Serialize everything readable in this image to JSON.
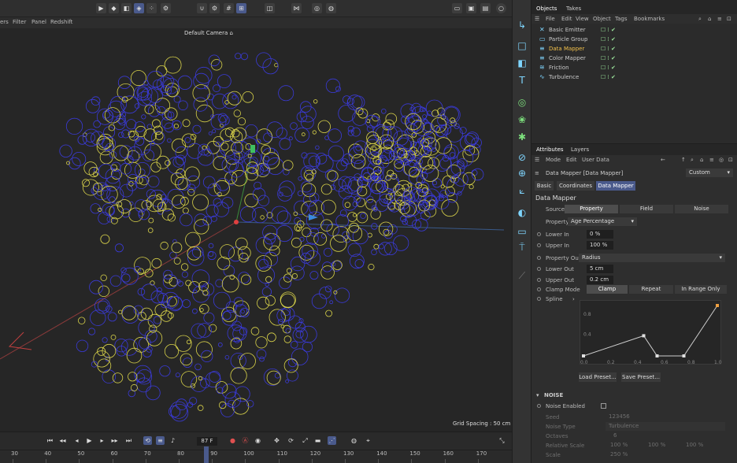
{
  "viewport": {
    "menu": [
      "ers",
      "Filter",
      "Panel",
      "Redshift"
    ],
    "camera_label": "Default Camera",
    "grid_spacing": "Grid Spacing : 50 cm"
  },
  "timeline": {
    "current_frame": "87 F",
    "ruler_labels": [
      "30",
      "40",
      "50",
      "60",
      "70",
      "80",
      "90",
      "100",
      "110",
      "120",
      "130",
      "140",
      "150",
      "160",
      "170"
    ]
  },
  "objects_panel": {
    "tabs": [
      "Objects",
      "Takes"
    ],
    "menu": [
      "File",
      "Edit",
      "View",
      "Object",
      "Tags",
      "Bookmarks"
    ],
    "items": [
      {
        "name": "Basic Emitter",
        "icon": "emitter-icon",
        "highlight": false
      },
      {
        "name": "Particle Group",
        "icon": "folder-icon",
        "highlight": false
      },
      {
        "name": "Data Mapper",
        "icon": "mapper-icon",
        "highlight": true
      },
      {
        "name": "Color Mapper",
        "icon": "color-mapper-icon",
        "highlight": false
      },
      {
        "name": "Friction",
        "icon": "friction-icon",
        "highlight": false
      },
      {
        "name": "Turbulence",
        "icon": "turbulence-icon",
        "highlight": false
      }
    ]
  },
  "attributes": {
    "tabs": [
      "Attributes",
      "Layers"
    ],
    "menu": [
      "Mode",
      "Edit",
      "User Data"
    ],
    "object_title": "Data Mapper [Data Mapper]",
    "preset": "Custom",
    "subtabs": [
      "Basic",
      "Coordinates",
      "Data Mapper"
    ],
    "section_title": "Data Mapper",
    "source_label": "Source",
    "source_options": [
      "Property",
      "Field",
      "Noise"
    ],
    "property_label": "Property",
    "property_value": "Age Percentage",
    "lower_in_label": "Lower In",
    "lower_in": "0 %",
    "upper_in_label": "Upper In",
    "upper_in": "100 %",
    "property_out_label": "Property Out",
    "property_out": "Radius",
    "lower_out_label": "Lower Out",
    "lower_out": "5 cm",
    "upper_out_label": "Upper Out",
    "upper_out": "0.2 cm",
    "clamp_label": "Clamp Mode",
    "clamp_options": [
      "Clamp",
      "Repeat",
      "In Range Only"
    ],
    "spline_label": "Spline",
    "spline_y_ticks": [
      "0.8",
      "0.4"
    ],
    "spline_x_ticks": [
      "0.0",
      "0.2",
      "0.4",
      "0.6",
      "0.8",
      "1.0"
    ],
    "spline_points": [
      [
        0.0,
        0.0
      ],
      [
        0.45,
        0.4
      ],
      [
        0.55,
        0.0
      ],
      [
        0.75,
        0.0
      ],
      [
        1.0,
        1.0
      ]
    ],
    "load_preset": "Load Preset...",
    "save_preset": "Save Preset...",
    "noise_title": "NOISE",
    "noise_enabled_label": "Noise Enabled",
    "seed_label": "Seed",
    "seed": "123456",
    "noise_type_label": "Noise Type",
    "noise_type": "Turbulence",
    "octaves_label": "Octaves",
    "octaves": "6",
    "relative_scale_label": "Relative Scale",
    "relative_scale": [
      "100 %",
      "100 %",
      "100 %"
    ],
    "scale_label": "Scale",
    "scale": "250 %"
  }
}
